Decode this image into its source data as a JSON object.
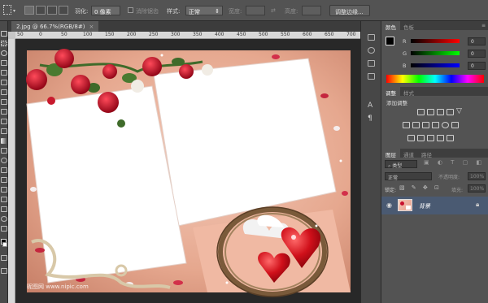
{
  "options_bar": {
    "feather_label": "羽化:",
    "feather_value": "0 像素",
    "antialias_label": "消除锯齿",
    "style_label": "样式:",
    "style_value": "正常",
    "width_label": "宽度:",
    "height_label": "高度:",
    "refine_button": "调整边缘..."
  },
  "document_tab": {
    "title": "2.jpg @ 66.7%(RGB/8#)",
    "close": "×"
  },
  "ruler": {
    "ticks": [
      "50",
      "0",
      "50",
      "100",
      "150",
      "200",
      "250",
      "300",
      "350",
      "400",
      "450",
      "500",
      "550",
      "600",
      "650",
      "700"
    ]
  },
  "watermark_text": "昵图网 www.nipic.com",
  "color_panel": {
    "tabs": [
      "颜色",
      "色板"
    ],
    "channels": [
      {
        "label": "R",
        "value": "0"
      },
      {
        "label": "G",
        "value": "0"
      },
      {
        "label": "B",
        "value": "0"
      }
    ]
  },
  "adjustments_panel": {
    "tabs": [
      "调整",
      "样式"
    ],
    "title": "添加调整"
  },
  "layers_panel": {
    "tabs": [
      "图层",
      "通道",
      "路径"
    ],
    "filter_label": "类型",
    "blend_mode": "正常",
    "opacity_label": "不透明度:",
    "opacity_value": "100%",
    "lock_label": "锁定:",
    "fill_label": "填充:",
    "fill_value": "100%",
    "layer_name": "背景"
  },
  "colors": {
    "panel_bg": "#535353",
    "canvas_pink": "#e8a58f",
    "rose_red": "#c8102e",
    "selected_layer": "#4a5a72"
  }
}
